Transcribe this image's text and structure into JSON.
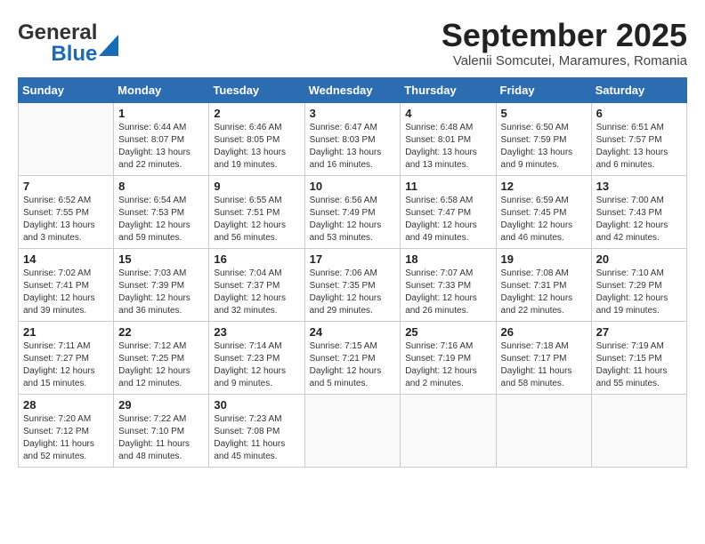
{
  "header": {
    "logo_general": "General",
    "logo_blue": "Blue",
    "month_title": "September 2025",
    "subtitle": "Valenii Somcutei, Maramures, Romania"
  },
  "calendar": {
    "days_of_week": [
      "Sunday",
      "Monday",
      "Tuesday",
      "Wednesday",
      "Thursday",
      "Friday",
      "Saturday"
    ],
    "weeks": [
      [
        {
          "day": "",
          "info": ""
        },
        {
          "day": "1",
          "info": "Sunrise: 6:44 AM\nSunset: 8:07 PM\nDaylight: 13 hours\nand 22 minutes."
        },
        {
          "day": "2",
          "info": "Sunrise: 6:46 AM\nSunset: 8:05 PM\nDaylight: 13 hours\nand 19 minutes."
        },
        {
          "day": "3",
          "info": "Sunrise: 6:47 AM\nSunset: 8:03 PM\nDaylight: 13 hours\nand 16 minutes."
        },
        {
          "day": "4",
          "info": "Sunrise: 6:48 AM\nSunset: 8:01 PM\nDaylight: 13 hours\nand 13 minutes."
        },
        {
          "day": "5",
          "info": "Sunrise: 6:50 AM\nSunset: 7:59 PM\nDaylight: 13 hours\nand 9 minutes."
        },
        {
          "day": "6",
          "info": "Sunrise: 6:51 AM\nSunset: 7:57 PM\nDaylight: 13 hours\nand 6 minutes."
        }
      ],
      [
        {
          "day": "7",
          "info": "Sunrise: 6:52 AM\nSunset: 7:55 PM\nDaylight: 13 hours\nand 3 minutes."
        },
        {
          "day": "8",
          "info": "Sunrise: 6:54 AM\nSunset: 7:53 PM\nDaylight: 12 hours\nand 59 minutes."
        },
        {
          "day": "9",
          "info": "Sunrise: 6:55 AM\nSunset: 7:51 PM\nDaylight: 12 hours\nand 56 minutes."
        },
        {
          "day": "10",
          "info": "Sunrise: 6:56 AM\nSunset: 7:49 PM\nDaylight: 12 hours\nand 53 minutes."
        },
        {
          "day": "11",
          "info": "Sunrise: 6:58 AM\nSunset: 7:47 PM\nDaylight: 12 hours\nand 49 minutes."
        },
        {
          "day": "12",
          "info": "Sunrise: 6:59 AM\nSunset: 7:45 PM\nDaylight: 12 hours\nand 46 minutes."
        },
        {
          "day": "13",
          "info": "Sunrise: 7:00 AM\nSunset: 7:43 PM\nDaylight: 12 hours\nand 42 minutes."
        }
      ],
      [
        {
          "day": "14",
          "info": "Sunrise: 7:02 AM\nSunset: 7:41 PM\nDaylight: 12 hours\nand 39 minutes."
        },
        {
          "day": "15",
          "info": "Sunrise: 7:03 AM\nSunset: 7:39 PM\nDaylight: 12 hours\nand 36 minutes."
        },
        {
          "day": "16",
          "info": "Sunrise: 7:04 AM\nSunset: 7:37 PM\nDaylight: 12 hours\nand 32 minutes."
        },
        {
          "day": "17",
          "info": "Sunrise: 7:06 AM\nSunset: 7:35 PM\nDaylight: 12 hours\nand 29 minutes."
        },
        {
          "day": "18",
          "info": "Sunrise: 7:07 AM\nSunset: 7:33 PM\nDaylight: 12 hours\nand 26 minutes."
        },
        {
          "day": "19",
          "info": "Sunrise: 7:08 AM\nSunset: 7:31 PM\nDaylight: 12 hours\nand 22 minutes."
        },
        {
          "day": "20",
          "info": "Sunrise: 7:10 AM\nSunset: 7:29 PM\nDaylight: 12 hours\nand 19 minutes."
        }
      ],
      [
        {
          "day": "21",
          "info": "Sunrise: 7:11 AM\nSunset: 7:27 PM\nDaylight: 12 hours\nand 15 minutes."
        },
        {
          "day": "22",
          "info": "Sunrise: 7:12 AM\nSunset: 7:25 PM\nDaylight: 12 hours\nand 12 minutes."
        },
        {
          "day": "23",
          "info": "Sunrise: 7:14 AM\nSunset: 7:23 PM\nDaylight: 12 hours\nand 9 minutes."
        },
        {
          "day": "24",
          "info": "Sunrise: 7:15 AM\nSunset: 7:21 PM\nDaylight: 12 hours\nand 5 minutes."
        },
        {
          "day": "25",
          "info": "Sunrise: 7:16 AM\nSunset: 7:19 PM\nDaylight: 12 hours\nand 2 minutes."
        },
        {
          "day": "26",
          "info": "Sunrise: 7:18 AM\nSunset: 7:17 PM\nDaylight: 11 hours\nand 58 minutes."
        },
        {
          "day": "27",
          "info": "Sunrise: 7:19 AM\nSunset: 7:15 PM\nDaylight: 11 hours\nand 55 minutes."
        }
      ],
      [
        {
          "day": "28",
          "info": "Sunrise: 7:20 AM\nSunset: 7:12 PM\nDaylight: 11 hours\nand 52 minutes."
        },
        {
          "day": "29",
          "info": "Sunrise: 7:22 AM\nSunset: 7:10 PM\nDaylight: 11 hours\nand 48 minutes."
        },
        {
          "day": "30",
          "info": "Sunrise: 7:23 AM\nSunset: 7:08 PM\nDaylight: 11 hours\nand 45 minutes."
        },
        {
          "day": "",
          "info": ""
        },
        {
          "day": "",
          "info": ""
        },
        {
          "day": "",
          "info": ""
        },
        {
          "day": "",
          "info": ""
        }
      ]
    ]
  }
}
